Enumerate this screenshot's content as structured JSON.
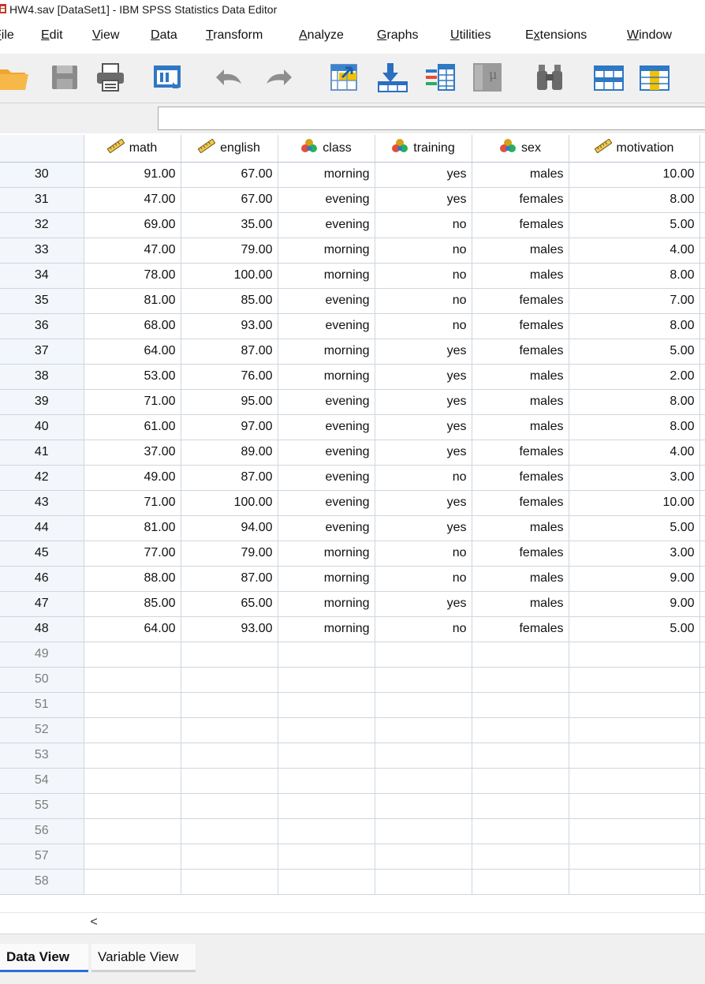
{
  "window": {
    "title": "HW4.sav [DataSet1] - IBM SPSS Statistics Data Editor"
  },
  "menu": [
    {
      "label_pre": "",
      "label_u": "F",
      "label_post": "ile"
    },
    {
      "label_pre": "",
      "label_u": "E",
      "label_post": "dit"
    },
    {
      "label_pre": "",
      "label_u": "V",
      "label_post": "iew"
    },
    {
      "label_pre": "",
      "label_u": "D",
      "label_post": "ata"
    },
    {
      "label_pre": "",
      "label_u": "T",
      "label_post": "ransform"
    },
    {
      "label_pre": "",
      "label_u": "A",
      "label_post": "nalyze"
    },
    {
      "label_pre": "",
      "label_u": "G",
      "label_post": "raphs"
    },
    {
      "label_pre": "",
      "label_u": "U",
      "label_post": "tilities"
    },
    {
      "label_pre": "E",
      "label_u": "x",
      "label_post": "tensions"
    },
    {
      "label_pre": "",
      "label_u": "W",
      "label_post": "indow"
    }
  ],
  "toolbar": {
    "icons": [
      "open-folder-icon",
      "save-icon",
      "print-icon",
      "recall-dialog-icon",
      "undo-icon",
      "redo-icon",
      "goto-case-icon",
      "goto-variable-icon",
      "variables-icon",
      "run-descriptives-icon",
      "find-icon",
      "insert-cases-icon",
      "insert-variable-icon"
    ]
  },
  "cell_editor": {
    "value": ""
  },
  "columns": [
    {
      "name": "math",
      "type": "scale-icon"
    },
    {
      "name": "english",
      "type": "scale-icon"
    },
    {
      "name": "class",
      "type": "nominal-icon"
    },
    {
      "name": "training",
      "type": "nominal-icon"
    },
    {
      "name": "sex",
      "type": "nominal-icon"
    },
    {
      "name": "motivation",
      "type": "scale-icon"
    }
  ],
  "rows": [
    {
      "n": "30",
      "math": "91.00",
      "english": "67.00",
      "class": "morning",
      "training": "yes",
      "sex": "males",
      "motivation": "10.00"
    },
    {
      "n": "31",
      "math": "47.00",
      "english": "67.00",
      "class": "evening",
      "training": "yes",
      "sex": "females",
      "motivation": "8.00"
    },
    {
      "n": "32",
      "math": "69.00",
      "english": "35.00",
      "class": "evening",
      "training": "no",
      "sex": "females",
      "motivation": "5.00"
    },
    {
      "n": "33",
      "math": "47.00",
      "english": "79.00",
      "class": "morning",
      "training": "no",
      "sex": "males",
      "motivation": "4.00"
    },
    {
      "n": "34",
      "math": "78.00",
      "english": "100.00",
      "class": "morning",
      "training": "no",
      "sex": "males",
      "motivation": "8.00"
    },
    {
      "n": "35",
      "math": "81.00",
      "english": "85.00",
      "class": "evening",
      "training": "no",
      "sex": "females",
      "motivation": "7.00"
    },
    {
      "n": "36",
      "math": "68.00",
      "english": "93.00",
      "class": "evening",
      "training": "no",
      "sex": "females",
      "motivation": "8.00"
    },
    {
      "n": "37",
      "math": "64.00",
      "english": "87.00",
      "class": "morning",
      "training": "yes",
      "sex": "females",
      "motivation": "5.00"
    },
    {
      "n": "38",
      "math": "53.00",
      "english": "76.00",
      "class": "morning",
      "training": "yes",
      "sex": "males",
      "motivation": "2.00"
    },
    {
      "n": "39",
      "math": "71.00",
      "english": "95.00",
      "class": "evening",
      "training": "yes",
      "sex": "males",
      "motivation": "8.00"
    },
    {
      "n": "40",
      "math": "61.00",
      "english": "97.00",
      "class": "evening",
      "training": "yes",
      "sex": "males",
      "motivation": "8.00"
    },
    {
      "n": "41",
      "math": "37.00",
      "english": "89.00",
      "class": "evening",
      "training": "yes",
      "sex": "females",
      "motivation": "4.00"
    },
    {
      "n": "42",
      "math": "49.00",
      "english": "87.00",
      "class": "evening",
      "training": "no",
      "sex": "females",
      "motivation": "3.00"
    },
    {
      "n": "43",
      "math": "71.00",
      "english": "100.00",
      "class": "evening",
      "training": "yes",
      "sex": "females",
      "motivation": "10.00"
    },
    {
      "n": "44",
      "math": "81.00",
      "english": "94.00",
      "class": "evening",
      "training": "yes",
      "sex": "males",
      "motivation": "5.00"
    },
    {
      "n": "45",
      "math": "77.00",
      "english": "79.00",
      "class": "morning",
      "training": "no",
      "sex": "females",
      "motivation": "3.00"
    },
    {
      "n": "46",
      "math": "88.00",
      "english": "87.00",
      "class": "morning",
      "training": "no",
      "sex": "males",
      "motivation": "9.00"
    },
    {
      "n": "47",
      "math": "85.00",
      "english": "65.00",
      "class": "morning",
      "training": "yes",
      "sex": "males",
      "motivation": "9.00"
    },
    {
      "n": "48",
      "math": "64.00",
      "english": "93.00",
      "class": "morning",
      "training": "no",
      "sex": "females",
      "motivation": "5.00"
    }
  ],
  "empty_rows": [
    "49",
    "50",
    "51",
    "52",
    "53",
    "54",
    "55",
    "56",
    "57",
    "58"
  ],
  "scrollbar": {
    "left_arrow": "<"
  },
  "tabs": {
    "data_view": "Data View",
    "variable_view": "Variable View"
  },
  "colors": {
    "active_tab_underline": "#2b6fd6",
    "row_header_bg": "#f3f6fa",
    "grid_line": "#cfd6df"
  }
}
